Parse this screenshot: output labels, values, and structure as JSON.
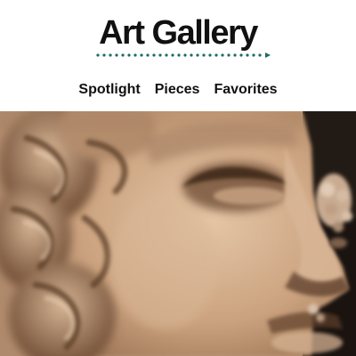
{
  "site": {
    "title": "Art Gallery",
    "accent_color": "#1f6b5e"
  },
  "nav": {
    "items": [
      {
        "label": "Spotlight"
      },
      {
        "label": "Pieces"
      },
      {
        "label": "Favorites"
      }
    ]
  },
  "hero": {
    "image": "sculpture-bust-close-up"
  }
}
